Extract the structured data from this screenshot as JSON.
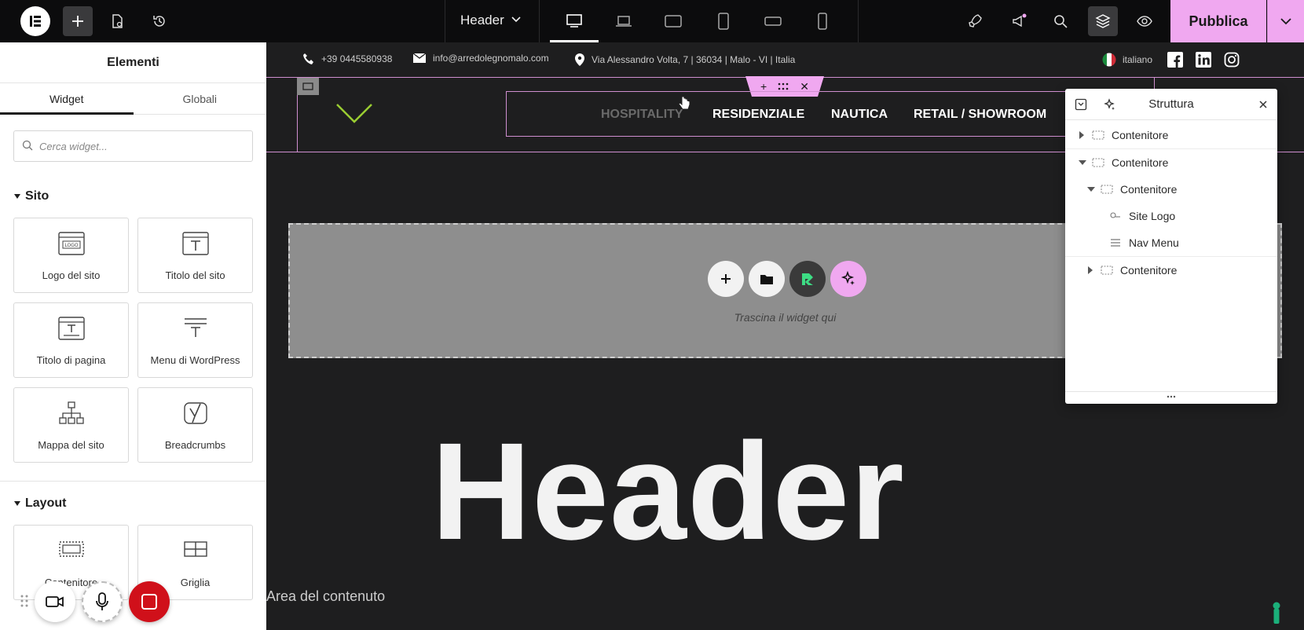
{
  "topbar": {
    "document_title": "Header",
    "publish_label": "Pubblica"
  },
  "panel": {
    "title": "Elementi",
    "tabs": [
      "Widget",
      "Globali"
    ],
    "search_placeholder": "Cerca widget...",
    "sections": {
      "site": {
        "title": "Sito",
        "widgets": [
          "Logo del sito",
          "Titolo del sito",
          "Titolo di pagina",
          "Menu di WordPress",
          "Mappa del sito",
          "Breadcrumbs"
        ]
      },
      "layout": {
        "title": "Layout",
        "widgets": [
          "Contenitore",
          "Griglia"
        ]
      }
    }
  },
  "canvas": {
    "phone": "+39 0445580938",
    "email": "info@arredolegnomalo.com",
    "address": "Via Alessandro Volta, 7 | 36034 | Malo - VI | Italia",
    "language": "italiano",
    "nav": [
      "HOSPITALITY",
      "RESIDENZIALE",
      "NAUTICA",
      "RETAIL / SHOWROOM"
    ],
    "dropzone_text": "Trascina il widget qui",
    "big_title": "Header",
    "content_area": "Area del contenuto"
  },
  "structure": {
    "title": "Struttura",
    "rows": [
      "Contenitore",
      "Contenitore",
      "Contenitore",
      "Site Logo",
      "Nav Menu",
      "Contenitore"
    ]
  },
  "colors": {
    "accent": "#f0a8f0",
    "record": "#d0101a",
    "logo_green": "#9acd32"
  }
}
